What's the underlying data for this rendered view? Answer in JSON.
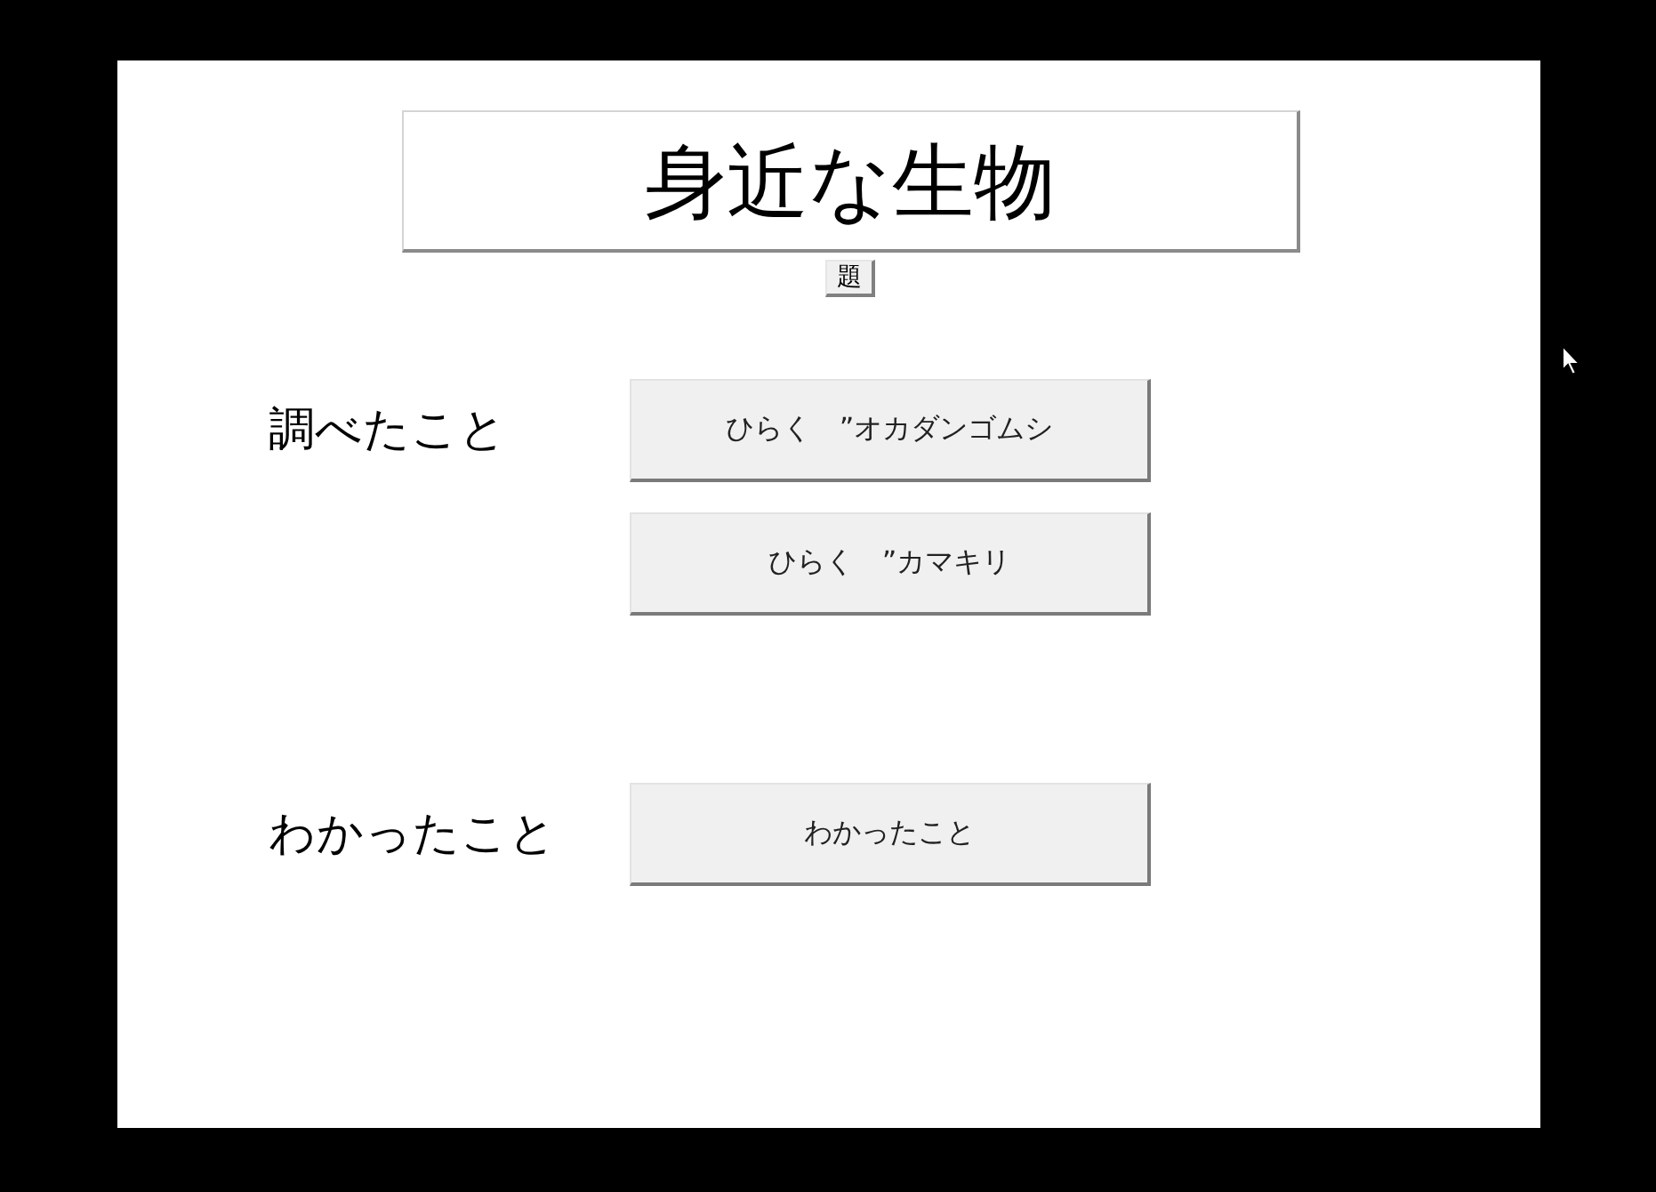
{
  "title": {
    "text": "身近な生物"
  },
  "title_button": {
    "label": "題"
  },
  "sections": [
    {
      "heading": "調べたこと",
      "buttons": [
        {
          "label": "ひらく　”オカダンゴムシ"
        },
        {
          "label": "ひらく　”カマキリ"
        }
      ]
    },
    {
      "heading": "わかったこと",
      "buttons": [
        {
          "label": "わかったこと"
        }
      ]
    }
  ]
}
